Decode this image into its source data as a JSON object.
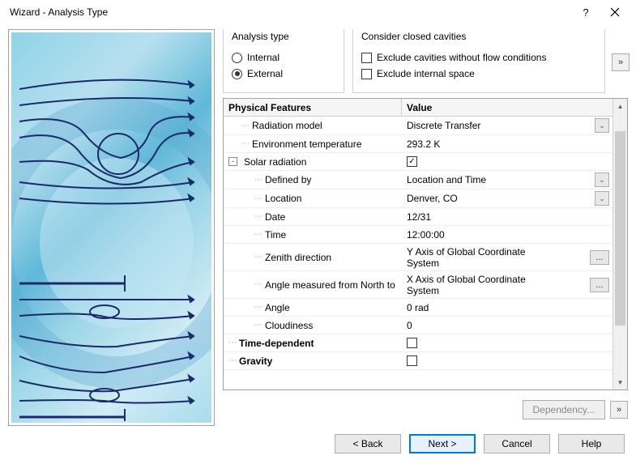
{
  "title": "Wizard - Analysis Type",
  "analysis_type": {
    "label": "Analysis type",
    "internal": "Internal",
    "external": "External",
    "selected": "External"
  },
  "cavities": {
    "label": "Consider closed cavities",
    "exclude_flow": "Exclude cavities without flow conditions",
    "exclude_internal": "Exclude internal space"
  },
  "grid": {
    "header_feature": "Physical Features",
    "header_value": "Value",
    "rows": [
      {
        "name": "Radiation model",
        "value": "Discrete Transfer",
        "indent": 1,
        "dd": true
      },
      {
        "name": "Environment temperature",
        "value": "293.2 K",
        "indent": 1
      },
      {
        "name": "Solar radiation",
        "value_chk": true,
        "indent": 0,
        "expander": "-"
      },
      {
        "name": "Defined by",
        "value": "Location and Time",
        "indent": 2,
        "dd": true
      },
      {
        "name": "Location",
        "value": "Denver, CO",
        "indent": 2,
        "dd": true
      },
      {
        "name": "Date",
        "value": "12/31",
        "indent": 2
      },
      {
        "name": "Time",
        "value": "12:00:00",
        "indent": 2
      },
      {
        "name": "Zenith direction",
        "value": "Y  Axis of Global Coordinate System",
        "indent": 2,
        "elps": true,
        "tall": true
      },
      {
        "name": "Angle measured from North to",
        "value": "X  Axis of Global Coordinate System",
        "indent": 2,
        "elps": true,
        "tall": true
      },
      {
        "name": "Angle",
        "value": "0 rad",
        "indent": 2
      },
      {
        "name": "Cloudiness",
        "value": "0",
        "indent": 2
      },
      {
        "name": "Time-dependent",
        "value_chk": false,
        "indent": 0,
        "bold": true
      },
      {
        "name": "Gravity",
        "value_chk": false,
        "indent": 0,
        "bold": true
      }
    ]
  },
  "dependency": "Dependency...",
  "buttons": {
    "back": "< Back",
    "next": "Next >",
    "cancel": "Cancel",
    "help": "Help"
  },
  "icons": {
    "expand": "»",
    "dropdown": "⌄",
    "ellipsis": "..."
  }
}
